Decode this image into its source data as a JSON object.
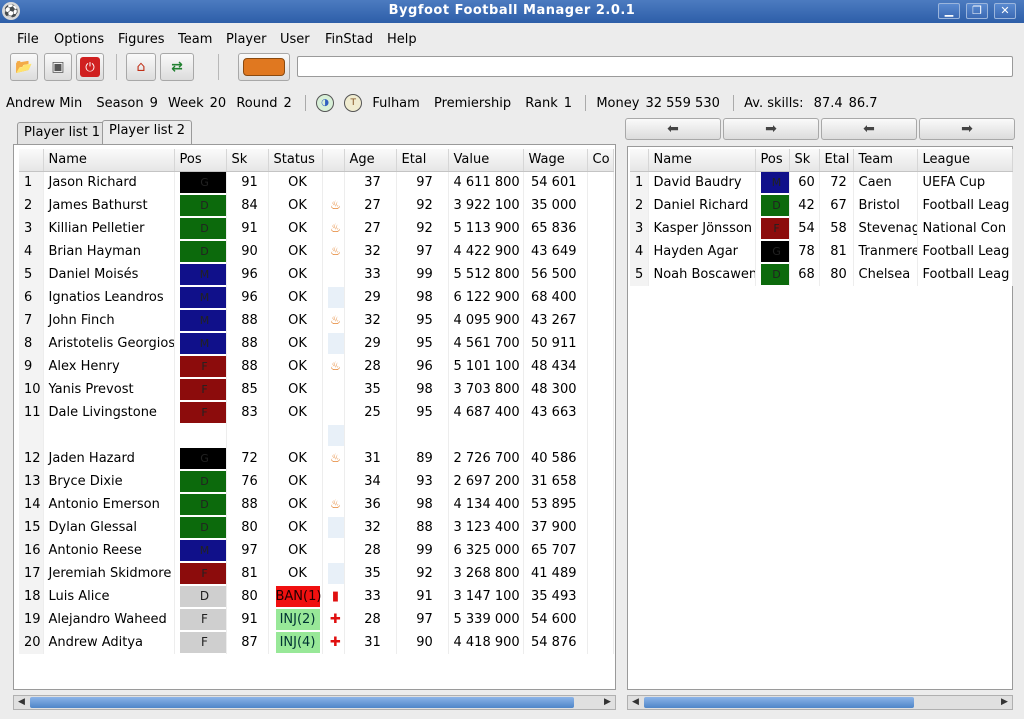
{
  "window": {
    "title": "Bygfoot Football Manager 2.0.1"
  },
  "menu": [
    "File",
    "Options",
    "Figures",
    "Team",
    "Player",
    "User",
    "FinStad",
    "Help"
  ],
  "toolbar": {
    "buttons": [
      "open-icon",
      "save-icon",
      "quit-icon",
      "home-icon",
      "transfer-icon",
      "bus-icon"
    ],
    "entry_value": ""
  },
  "info": {
    "user": "Andrew Min",
    "season_label": "Season",
    "season": "9",
    "week_label": "Week",
    "week": "20",
    "round_label": "Round",
    "round": "2",
    "team": "Fulham",
    "league": "Premiership",
    "rank_label": "Rank",
    "rank": "1",
    "money_label": "Money",
    "money": "32 559 530",
    "skills_label": "Av. skills:",
    "skill1": "87.4",
    "skill2": "86.7"
  },
  "tabs": [
    "Player list 1",
    "Player list 2"
  ],
  "left_table": {
    "columns": [
      "",
      "Name",
      "Pos",
      "Sk",
      "Status",
      "",
      "Age",
      "Etal",
      "Value",
      "Wage",
      "Co"
    ],
    "rows": [
      {
        "n": "1",
        "name": "Jason Richard",
        "pos": "G",
        "sk": "91",
        "status": "OK",
        "ex": "",
        "age": "37",
        "etal": "97",
        "value": "4 611 800",
        "wage": "54 601"
      },
      {
        "n": "2",
        "name": "James Bathurst",
        "pos": "D",
        "sk": "84",
        "status": "OK",
        "ex": "fire",
        "age": "27",
        "etal": "92",
        "value": "3 922 100",
        "wage": "35 000"
      },
      {
        "n": "3",
        "name": "Killian Pelletier",
        "pos": "D",
        "sk": "91",
        "status": "OK",
        "ex": "fire",
        "age": "27",
        "etal": "92",
        "value": "5 113 900",
        "wage": "65 836"
      },
      {
        "n": "4",
        "name": "Brian Hayman",
        "pos": "D",
        "sk": "90",
        "status": "OK",
        "ex": "fire",
        "age": "32",
        "etal": "97",
        "value": "4 422 900",
        "wage": "43 649"
      },
      {
        "n": "5",
        "name": "Daniel Moisés",
        "pos": "M",
        "sk": "96",
        "status": "OK",
        "ex": "",
        "age": "33",
        "etal": "99",
        "value": "5 512 800",
        "wage": "56 500"
      },
      {
        "n": "6",
        "name": "Ignatios Leandros",
        "pos": "M",
        "sk": "96",
        "status": "OK",
        "ex": "pale",
        "age": "29",
        "etal": "98",
        "value": "6 122 900",
        "wage": "68 400"
      },
      {
        "n": "7",
        "name": "John Finch",
        "pos": "M",
        "sk": "88",
        "status": "OK",
        "ex": "fire",
        "age": "32",
        "etal": "95",
        "value": "4 095 900",
        "wage": "43 267"
      },
      {
        "n": "8",
        "name": "Aristotelis Georgios",
        "pos": "M",
        "sk": "88",
        "status": "OK",
        "ex": "pale",
        "age": "29",
        "etal": "95",
        "value": "4 561 700",
        "wage": "50 911"
      },
      {
        "n": "9",
        "name": "Alex Henry",
        "pos": "F",
        "sk": "88",
        "status": "OK",
        "ex": "fire",
        "age": "28",
        "etal": "96",
        "value": "5 101 100",
        "wage": "48 434"
      },
      {
        "n": "10",
        "name": "Yanis Prevost",
        "pos": "F",
        "sk": "85",
        "status": "OK",
        "ex": "",
        "age": "35",
        "etal": "98",
        "value": "3 703 800",
        "wage": "48 300"
      },
      {
        "n": "11",
        "name": "Dale Livingstone",
        "pos": "F",
        "sk": "83",
        "status": "OK",
        "ex": "",
        "age": "25",
        "etal": "95",
        "value": "4 687 400",
        "wage": "43 663"
      },
      {
        "n": "",
        "name": "",
        "pos": "",
        "sk": "",
        "status": "",
        "ex": "pale",
        "age": "",
        "etal": "",
        "value": "",
        "wage": ""
      },
      {
        "n": "12",
        "name": "Jaden Hazard",
        "pos": "G",
        "sk": "72",
        "status": "OK",
        "ex": "fire",
        "age": "31",
        "etal": "89",
        "value": "2 726 700",
        "wage": "40 586"
      },
      {
        "n": "13",
        "name": "Bryce Dixie",
        "pos": "D",
        "sk": "76",
        "status": "OK",
        "ex": "",
        "age": "34",
        "etal": "93",
        "value": "2 697 200",
        "wage": "31 658"
      },
      {
        "n": "14",
        "name": "Antonio Emerson",
        "pos": "D",
        "sk": "88",
        "status": "OK",
        "ex": "fire",
        "age": "36",
        "etal": "98",
        "value": "4 134 400",
        "wage": "53 895"
      },
      {
        "n": "15",
        "name": "Dylan Glessal",
        "pos": "D",
        "sk": "80",
        "status": "OK",
        "ex": "pale",
        "age": "32",
        "etal": "88",
        "value": "3 123 400",
        "wage": "37 900"
      },
      {
        "n": "16",
        "name": "Antonio Reese",
        "pos": "M",
        "sk": "97",
        "status": "OK",
        "ex": "",
        "age": "28",
        "etal": "99",
        "value": "6 325 000",
        "wage": "65 707"
      },
      {
        "n": "17",
        "name": "Jeremiah Skidmore",
        "pos": "F",
        "sk": "81",
        "status": "OK",
        "ex": "pale",
        "age": "35",
        "etal": "92",
        "value": "3 268 800",
        "wage": "41 489"
      },
      {
        "n": "18",
        "name": "Luis Alice",
        "pos": "D",
        "posLight": true,
        "sk": "80",
        "status": "BAN(1)",
        "ex": "card",
        "age": "33",
        "etal": "91",
        "value": "3 147 100",
        "wage": "35 493"
      },
      {
        "n": "19",
        "name": "Alejandro Waheed",
        "pos": "F",
        "posLight": true,
        "sk": "91",
        "status": "INJ(2)",
        "ex": "cross",
        "age": "28",
        "etal": "97",
        "value": "5 339 000",
        "wage": "54 600"
      },
      {
        "n": "20",
        "name": "Andrew Aditya",
        "pos": "F",
        "posLight": true,
        "sk": "87",
        "status": "INJ(4)",
        "ex": "cross",
        "age": "31",
        "etal": "90",
        "value": "4 418 900",
        "wage": "54 876"
      }
    ]
  },
  "right_table": {
    "columns": [
      "",
      "Name",
      "Pos",
      "Sk",
      "Etal",
      "Team",
      "League"
    ],
    "rows": [
      {
        "n": "1",
        "name": "David Baudry",
        "pos": "M",
        "sk": "60",
        "etal": "72",
        "team": "Caen",
        "league": "UEFA Cup"
      },
      {
        "n": "2",
        "name": "Daniel Richard",
        "pos": "D",
        "sk": "42",
        "etal": "67",
        "team": "Bristol",
        "league": "Football Leag"
      },
      {
        "n": "3",
        "name": "Kasper Jönsson",
        "pos": "F",
        "sk": "54",
        "etal": "58",
        "team": "Stevenage",
        "league": "National Con"
      },
      {
        "n": "4",
        "name": "Hayden Agar",
        "pos": "G",
        "sk": "78",
        "etal": "81",
        "team": "Tranmere",
        "league": "Football Leag"
      },
      {
        "n": "5",
        "name": "Noah Boscawen",
        "pos": "D",
        "sk": "68",
        "etal": "80",
        "team": "Chelsea",
        "league": "Football Leag"
      }
    ]
  }
}
